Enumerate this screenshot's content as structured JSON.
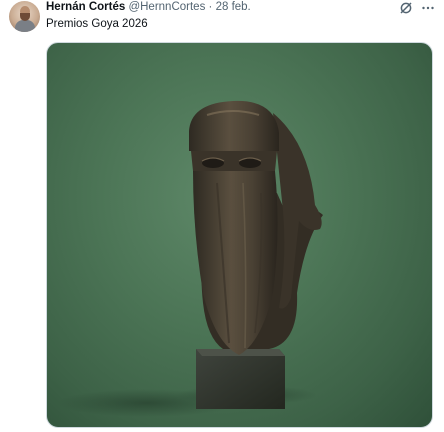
{
  "tweet": {
    "author_name": "Hernán Cortés",
    "handle": "@HernnCortes",
    "separator": "·",
    "date": "28 feb.",
    "text": "Premios Goya 2026"
  },
  "media": {
    "description_icon": "bronze-bust-photo"
  },
  "icons": {
    "grok": "grok-icon",
    "more": "more-icon"
  },
  "colors": {
    "text_primary": "#0f1419",
    "text_secondary": "#536471",
    "media_background": "#4c7556"
  }
}
